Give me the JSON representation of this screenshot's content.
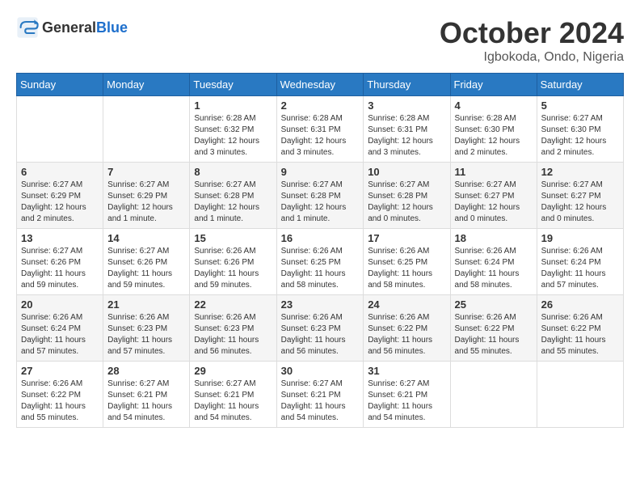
{
  "header": {
    "logo_general": "General",
    "logo_blue": "Blue",
    "month_title": "October 2024",
    "location": "Igbokoda, Ondo, Nigeria"
  },
  "weekdays": [
    "Sunday",
    "Monday",
    "Tuesday",
    "Wednesday",
    "Thursday",
    "Friday",
    "Saturday"
  ],
  "weeks": [
    [
      {
        "day": "",
        "info": ""
      },
      {
        "day": "",
        "info": ""
      },
      {
        "day": "1",
        "info": "Sunrise: 6:28 AM\nSunset: 6:32 PM\nDaylight: 12 hours and 3 minutes."
      },
      {
        "day": "2",
        "info": "Sunrise: 6:28 AM\nSunset: 6:31 PM\nDaylight: 12 hours and 3 minutes."
      },
      {
        "day": "3",
        "info": "Sunrise: 6:28 AM\nSunset: 6:31 PM\nDaylight: 12 hours and 3 minutes."
      },
      {
        "day": "4",
        "info": "Sunrise: 6:28 AM\nSunset: 6:30 PM\nDaylight: 12 hours and 2 minutes."
      },
      {
        "day": "5",
        "info": "Sunrise: 6:27 AM\nSunset: 6:30 PM\nDaylight: 12 hours and 2 minutes."
      }
    ],
    [
      {
        "day": "6",
        "info": "Sunrise: 6:27 AM\nSunset: 6:29 PM\nDaylight: 12 hours and 2 minutes."
      },
      {
        "day": "7",
        "info": "Sunrise: 6:27 AM\nSunset: 6:29 PM\nDaylight: 12 hours and 1 minute."
      },
      {
        "day": "8",
        "info": "Sunrise: 6:27 AM\nSunset: 6:28 PM\nDaylight: 12 hours and 1 minute."
      },
      {
        "day": "9",
        "info": "Sunrise: 6:27 AM\nSunset: 6:28 PM\nDaylight: 12 hours and 1 minute."
      },
      {
        "day": "10",
        "info": "Sunrise: 6:27 AM\nSunset: 6:28 PM\nDaylight: 12 hours and 0 minutes."
      },
      {
        "day": "11",
        "info": "Sunrise: 6:27 AM\nSunset: 6:27 PM\nDaylight: 12 hours and 0 minutes."
      },
      {
        "day": "12",
        "info": "Sunrise: 6:27 AM\nSunset: 6:27 PM\nDaylight: 12 hours and 0 minutes."
      }
    ],
    [
      {
        "day": "13",
        "info": "Sunrise: 6:27 AM\nSunset: 6:26 PM\nDaylight: 11 hours and 59 minutes."
      },
      {
        "day": "14",
        "info": "Sunrise: 6:27 AM\nSunset: 6:26 PM\nDaylight: 11 hours and 59 minutes."
      },
      {
        "day": "15",
        "info": "Sunrise: 6:26 AM\nSunset: 6:26 PM\nDaylight: 11 hours and 59 minutes."
      },
      {
        "day": "16",
        "info": "Sunrise: 6:26 AM\nSunset: 6:25 PM\nDaylight: 11 hours and 58 minutes."
      },
      {
        "day": "17",
        "info": "Sunrise: 6:26 AM\nSunset: 6:25 PM\nDaylight: 11 hours and 58 minutes."
      },
      {
        "day": "18",
        "info": "Sunrise: 6:26 AM\nSunset: 6:24 PM\nDaylight: 11 hours and 58 minutes."
      },
      {
        "day": "19",
        "info": "Sunrise: 6:26 AM\nSunset: 6:24 PM\nDaylight: 11 hours and 57 minutes."
      }
    ],
    [
      {
        "day": "20",
        "info": "Sunrise: 6:26 AM\nSunset: 6:24 PM\nDaylight: 11 hours and 57 minutes."
      },
      {
        "day": "21",
        "info": "Sunrise: 6:26 AM\nSunset: 6:23 PM\nDaylight: 11 hours and 57 minutes."
      },
      {
        "day": "22",
        "info": "Sunrise: 6:26 AM\nSunset: 6:23 PM\nDaylight: 11 hours and 56 minutes."
      },
      {
        "day": "23",
        "info": "Sunrise: 6:26 AM\nSunset: 6:23 PM\nDaylight: 11 hours and 56 minutes."
      },
      {
        "day": "24",
        "info": "Sunrise: 6:26 AM\nSunset: 6:22 PM\nDaylight: 11 hours and 56 minutes."
      },
      {
        "day": "25",
        "info": "Sunrise: 6:26 AM\nSunset: 6:22 PM\nDaylight: 11 hours and 55 minutes."
      },
      {
        "day": "26",
        "info": "Sunrise: 6:26 AM\nSunset: 6:22 PM\nDaylight: 11 hours and 55 minutes."
      }
    ],
    [
      {
        "day": "27",
        "info": "Sunrise: 6:26 AM\nSunset: 6:22 PM\nDaylight: 11 hours and 55 minutes."
      },
      {
        "day": "28",
        "info": "Sunrise: 6:27 AM\nSunset: 6:21 PM\nDaylight: 11 hours and 54 minutes."
      },
      {
        "day": "29",
        "info": "Sunrise: 6:27 AM\nSunset: 6:21 PM\nDaylight: 11 hours and 54 minutes."
      },
      {
        "day": "30",
        "info": "Sunrise: 6:27 AM\nSunset: 6:21 PM\nDaylight: 11 hours and 54 minutes."
      },
      {
        "day": "31",
        "info": "Sunrise: 6:27 AM\nSunset: 6:21 PM\nDaylight: 11 hours and 54 minutes."
      },
      {
        "day": "",
        "info": ""
      },
      {
        "day": "",
        "info": ""
      }
    ]
  ]
}
